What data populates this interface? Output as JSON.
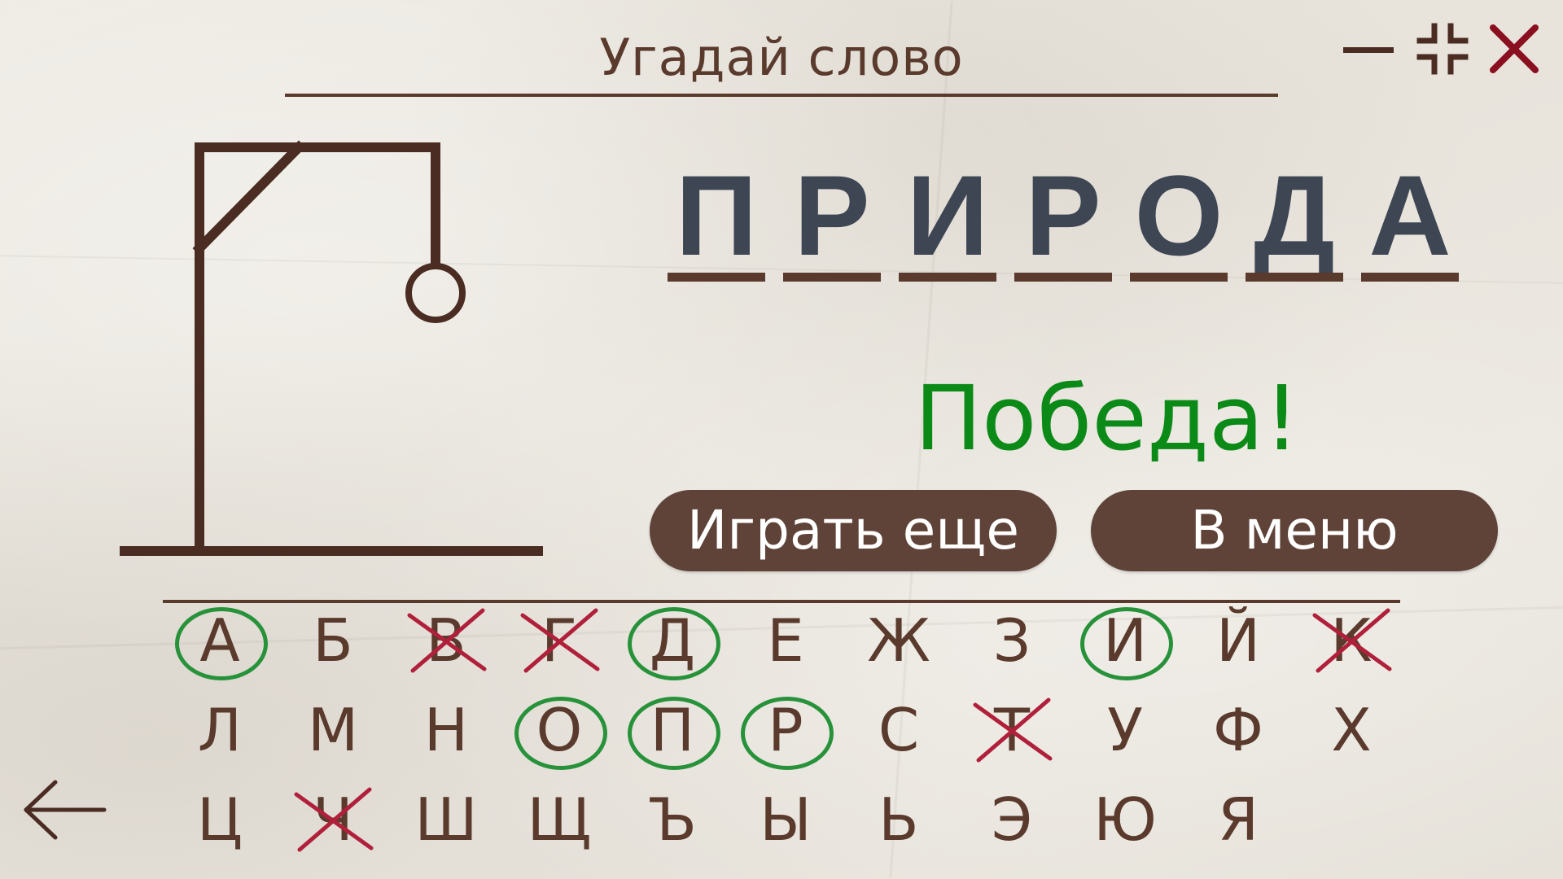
{
  "header": {
    "title": "Угадай слово"
  },
  "window_controls": {
    "minimize_icon": "minimize-icon",
    "restore_icon": "restore-icon",
    "close_icon": "close-icon",
    "close_color": "#8a1020"
  },
  "word": {
    "letters": [
      "П",
      "Р",
      "И",
      "Р",
      "О",
      "Д",
      "А"
    ]
  },
  "result": {
    "message": "Победа!",
    "color": "#0c8a18"
  },
  "buttons": {
    "play_again": "Играть еще",
    "menu": "В меню"
  },
  "keyboard": {
    "rows": [
      [
        {
          "letter": "А",
          "state": "correct"
        },
        {
          "letter": "Б",
          "state": "unused"
        },
        {
          "letter": "В",
          "state": "wrong"
        },
        {
          "letter": "Г",
          "state": "wrong"
        },
        {
          "letter": "Д",
          "state": "correct"
        },
        {
          "letter": "Е",
          "state": "unused"
        },
        {
          "letter": "Ж",
          "state": "unused"
        },
        {
          "letter": "З",
          "state": "unused"
        },
        {
          "letter": "И",
          "state": "correct"
        },
        {
          "letter": "Й",
          "state": "unused"
        },
        {
          "letter": "К",
          "state": "wrong"
        }
      ],
      [
        {
          "letter": "Л",
          "state": "unused"
        },
        {
          "letter": "М",
          "state": "unused"
        },
        {
          "letter": "Н",
          "state": "unused"
        },
        {
          "letter": "О",
          "state": "correct"
        },
        {
          "letter": "П",
          "state": "correct"
        },
        {
          "letter": "Р",
          "state": "correct"
        },
        {
          "letter": "С",
          "state": "unused"
        },
        {
          "letter": "Т",
          "state": "wrong"
        },
        {
          "letter": "У",
          "state": "unused"
        },
        {
          "letter": "Ф",
          "state": "unused"
        },
        {
          "letter": "Х",
          "state": "unused"
        }
      ],
      [
        {
          "letter": "Ц",
          "state": "unused"
        },
        {
          "letter": "Ч",
          "state": "wrong"
        },
        {
          "letter": "Ш",
          "state": "unused"
        },
        {
          "letter": "Щ",
          "state": "unused"
        },
        {
          "letter": "Ъ",
          "state": "unused"
        },
        {
          "letter": "Ы",
          "state": "unused"
        },
        {
          "letter": "Ь",
          "state": "unused"
        },
        {
          "letter": "Э",
          "state": "unused"
        },
        {
          "letter": "Ю",
          "state": "unused"
        },
        {
          "letter": "Я",
          "state": "unused"
        }
      ]
    ],
    "correct_color": "#27923a",
    "wrong_color": "#b0203a"
  },
  "navigation": {
    "back_icon": "arrow-left-icon"
  },
  "colors": {
    "ink": "#5a3a2c",
    "word_letter": "#3e4654",
    "button_bg": "#5f4338",
    "button_text": "#ffffff",
    "paper": "#ebe7e0"
  }
}
